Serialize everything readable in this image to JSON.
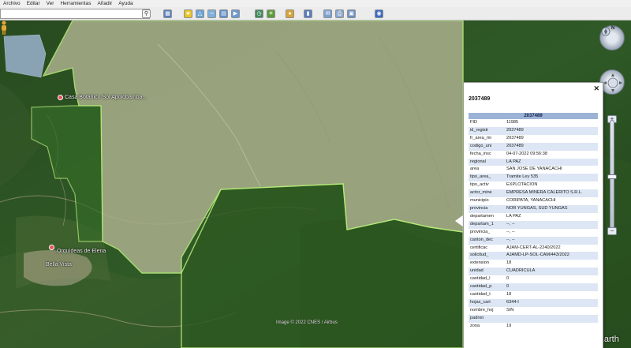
{
  "menu": [
    "Archivo",
    "Editar",
    "Ver",
    "Herramientas",
    "Añadir",
    "Ayuda"
  ],
  "search": {
    "value": ""
  },
  "toolbar_icons": [
    "sidebar-icon",
    "placemark-icon",
    "polygon-icon",
    "path-icon",
    "image-overlay-icon",
    "tour-icon",
    "history-icon",
    "sun-icon",
    "planets-icon",
    "ruler-icon",
    "email-icon",
    "print-icon",
    "save-image-icon",
    "maps-icon"
  ],
  "map": {
    "places": [
      "Casa Botánico Sol Apolobamba...",
      "Orquídeas de Elena",
      "Bella Vista"
    ],
    "imagery_credit": "Image © 2022 CNES / Airbus",
    "brand": "Google Earth"
  },
  "balloon": {
    "title": "2037489",
    "table_header": "2037489",
    "rows": [
      [
        "FID",
        "11985"
      ],
      [
        "id_registr",
        "2037489"
      ],
      [
        "fr_area_mi",
        "2037489"
      ],
      [
        "codigo_uni",
        "2037489"
      ],
      [
        "fecha_insc",
        "04-07-2022 09:56:38"
      ],
      [
        "regional",
        "LA PAZ"
      ],
      [
        "area",
        "SAN JOSE DE YANACACHI"
      ],
      [
        "tipo_area_",
        "Tramite Ley 535"
      ],
      [
        "tipo_activ",
        "EXPLOTACION"
      ],
      [
        "actor_mine",
        "EMPRESA MINERA CALERITO S.R.L."
      ],
      [
        "municipio",
        "CORIPATA, YANACACHI"
      ],
      [
        "provincia",
        "NOR YUNGAS, SUD YUNGAS"
      ],
      [
        "departamen",
        "LA PAZ"
      ],
      [
        "departam_1",
        "--, --"
      ],
      [
        "provincia_",
        "--, --"
      ],
      [
        "canton_dec",
        "--, --"
      ],
      [
        "certificac",
        "AJAM-CERT-AL-2240/2022"
      ],
      [
        "solicitud_",
        "AJAMD-LP-SOL-CAM/443/2022"
      ],
      [
        "extension",
        "18"
      ],
      [
        "unidad",
        "CUADRICULA"
      ],
      [
        "cantidad_l",
        "0"
      ],
      [
        "cantidad_p",
        "0"
      ],
      [
        "cantidad_t",
        "18"
      ],
      [
        "hojas_cart",
        "6344-I"
      ],
      [
        "nombre_hoj",
        "SIN"
      ],
      [
        "padron",
        ""
      ],
      [
        "zona",
        "19"
      ]
    ]
  }
}
